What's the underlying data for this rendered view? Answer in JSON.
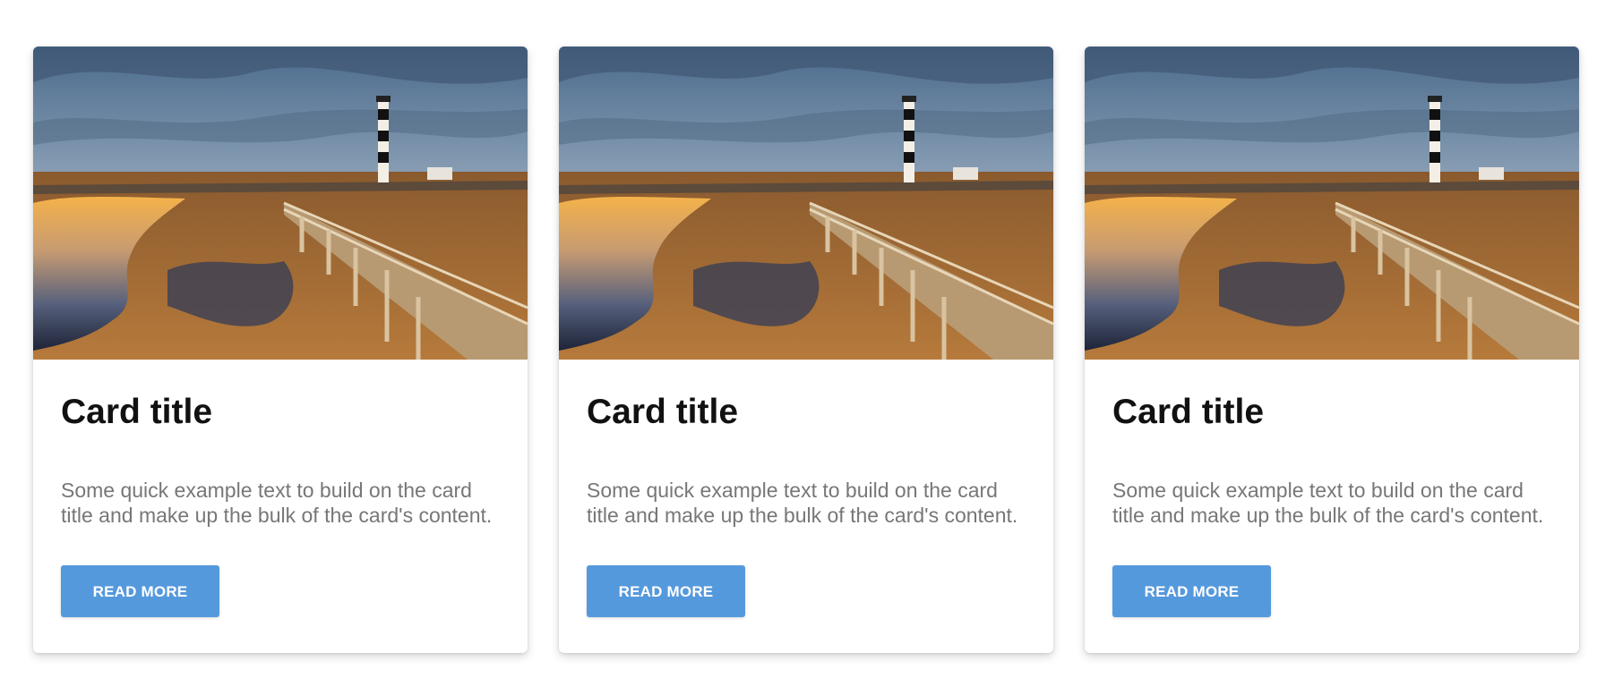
{
  "cards": [
    {
      "title": "Card title",
      "text": "Some quick example text to build on the card title and make up the bulk of the card's content.",
      "button_label": "READ MORE",
      "image_alt": "lighthouse-marsh-sunset-photo"
    },
    {
      "title": "Card title",
      "text": "Some quick example text to build on the card title and make up the bulk of the card's content.",
      "button_label": "READ MORE",
      "image_alt": "lighthouse-marsh-sunset-photo"
    },
    {
      "title": "Card title",
      "text": "Some quick example text to build on the card title and make up the bulk of the card's content.",
      "button_label": "READ MORE",
      "image_alt": "lighthouse-marsh-sunset-photo"
    }
  ],
  "colors": {
    "button": "#5599dd",
    "title": "#111111",
    "text": "#777777"
  }
}
